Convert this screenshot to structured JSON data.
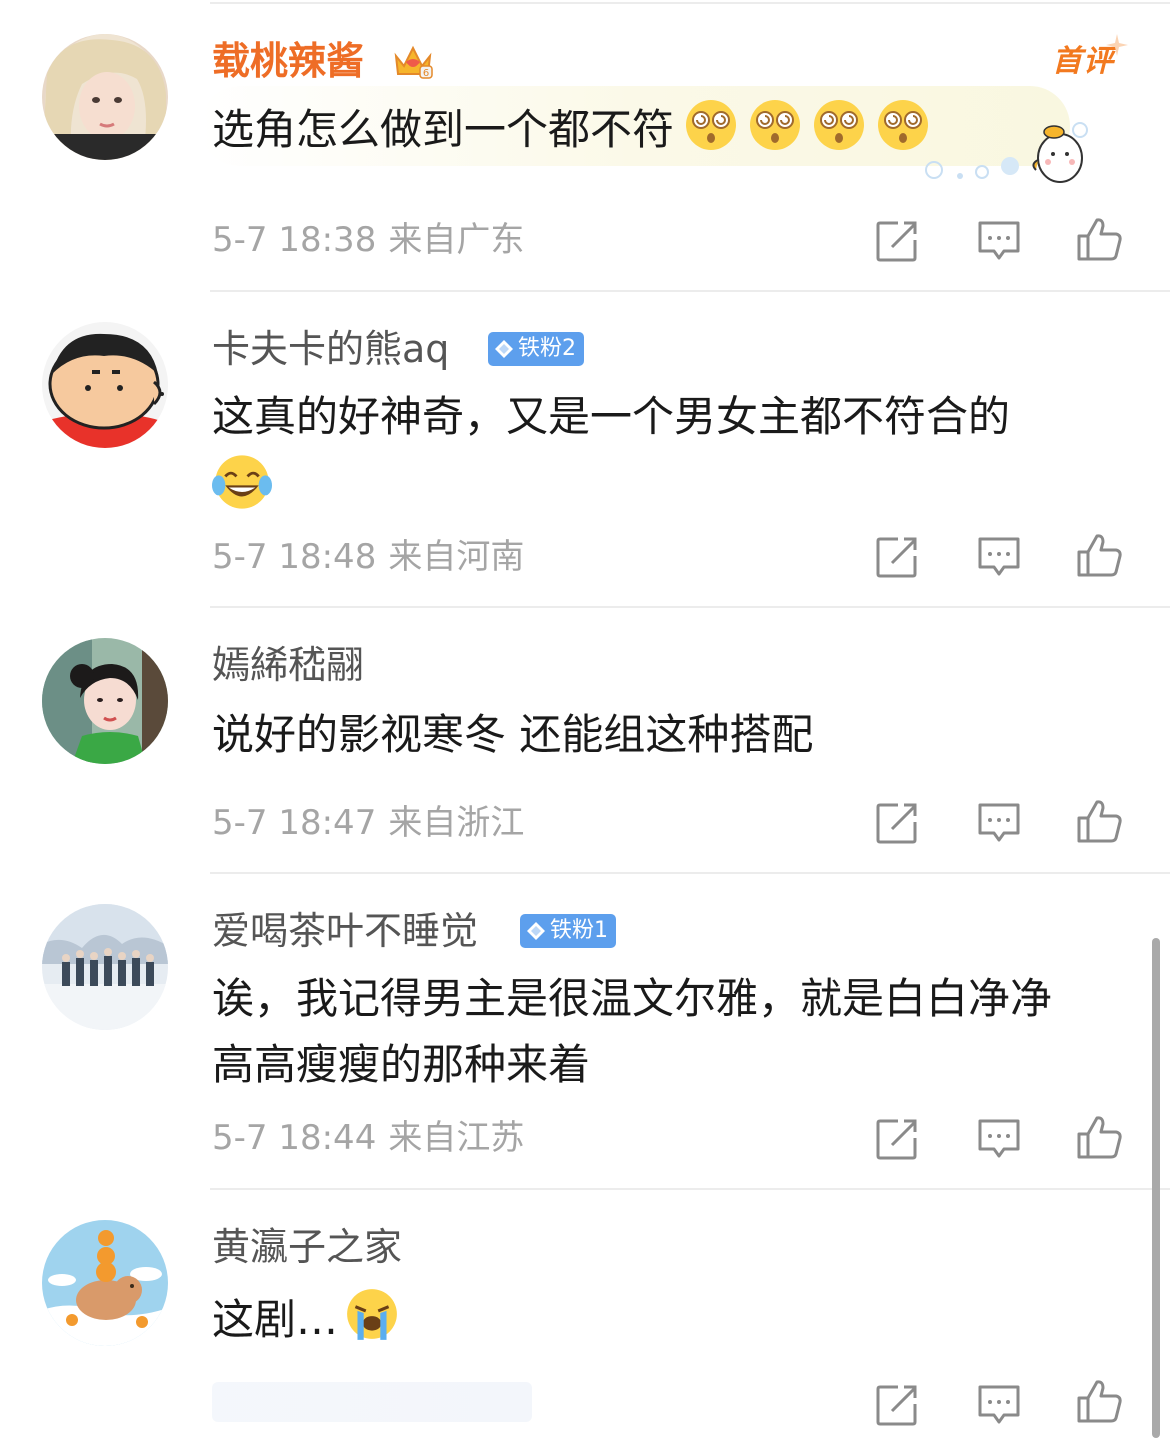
{
  "comments": [
    {
      "username": "载桃辣酱",
      "text": "选角怎么做到一个都不符",
      "date": "5-7 18:38",
      "location": "来自广东",
      "first_comment_label": "首评",
      "emoji": [
        "dizzy-face-emoji",
        "dizzy-face-emoji",
        "dizzy-face-emoji",
        "dizzy-face-emoji"
      ]
    },
    {
      "username": "卡夫卡的熊aq",
      "badge": "铁粉2",
      "text_line1": "这真的好神奇，又是一个男女主都不符合的",
      "emoji": [
        "tears-of-joy-emoji"
      ],
      "date": "5-7 18:48",
      "location": "来自河南"
    },
    {
      "username": "嫣絺嵇翮",
      "text": "说好的影视寒冬 还能组这种搭配",
      "date": "5-7 18:47",
      "location": "来自浙江"
    },
    {
      "username": "爱喝茶叶不睡觉",
      "badge": "铁粉1",
      "text_line1": "诶，我记得男主是很温文尔雅，就是白白净净",
      "text_line2": "高高瘦瘦的那种来着",
      "date": "5-7 18:44",
      "location": "来自江苏"
    },
    {
      "username": "黄瀛子之家",
      "text": "这剧…",
      "emoji": [
        "loudly-crying-emoji"
      ]
    }
  ],
  "colors": {
    "vip_name": "#ee6d26",
    "name": "#555555",
    "badge_bg": "#5d9fed",
    "meta": "#a5a5a5",
    "icon": "#8a8a8a",
    "first_comment": "#f2791f"
  },
  "icons": {
    "share": "share-icon",
    "comment": "comment-icon",
    "like": "like-icon",
    "vip_crown": "crown-icon",
    "fan_badge": "diamond-icon"
  }
}
